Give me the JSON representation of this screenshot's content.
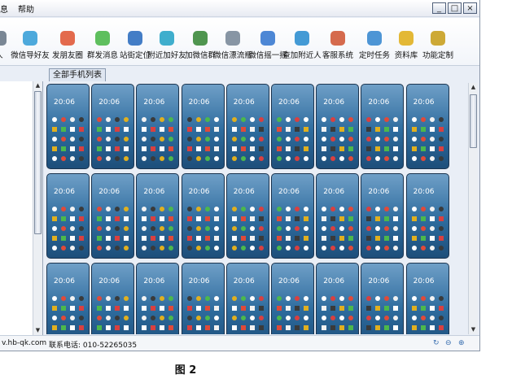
{
  "menu": {
    "items": [
      "息",
      "帮助"
    ]
  },
  "window_buttons": {
    "minimize": "_",
    "maximize": "□",
    "close": "×"
  },
  "toolbar": {
    "items": [
      {
        "label": "人",
        "icon": "partial-icon",
        "color": "#6b7a8a"
      },
      {
        "label": "微信导好友",
        "icon": "person-icon",
        "color": "#3aa0d8"
      },
      {
        "label": "发朋友圈",
        "icon": "aperture-icon",
        "color": "#e05a3a"
      },
      {
        "label": "群发消息",
        "icon": "wechat-icon",
        "color": "#4cb84c"
      },
      {
        "label": "站街定位",
        "icon": "pin-icon",
        "color": "#2f6fc0"
      },
      {
        "label": "附近加好友",
        "icon": "people-icon",
        "color": "#2aa5c8"
      },
      {
        "label": "加微信群",
        "icon": "qr-icon",
        "color": "#3c8a3c"
      },
      {
        "label": "微信漂流瓶",
        "icon": "bottle-icon",
        "color": "#7a8a9a"
      },
      {
        "label": "微信摇一摇",
        "icon": "shake-icon",
        "color": "#3a7ad0"
      },
      {
        "label": "查加附近人",
        "icon": "search-person-icon",
        "color": "#2f8fd0"
      },
      {
        "label": "客服系统",
        "icon": "agent-icon",
        "color": "#d05a3a"
      },
      {
        "label": "定时任务",
        "icon": "clock-icon",
        "color": "#3a8ad0"
      },
      {
        "label": "资料库",
        "icon": "database-icon",
        "color": "#e0b020"
      },
      {
        "label": "功能定制",
        "icon": "gear-icon",
        "color": "#c8a020"
      }
    ]
  },
  "tab": {
    "label": "全部手机列表"
  },
  "phones": {
    "time": "20:06",
    "rows": 3,
    "cols": 9
  },
  "status": {
    "url": "v.hb-qk.com",
    "phone": "联系电话: 010-52265035"
  },
  "caption": "图 2"
}
